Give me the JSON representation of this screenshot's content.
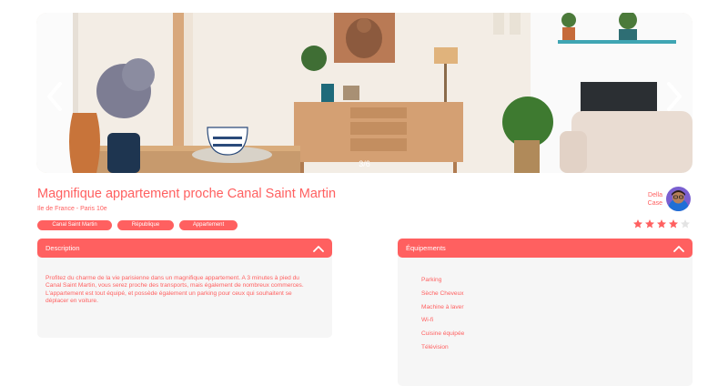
{
  "carousel": {
    "counter": "3/6"
  },
  "listing": {
    "title": "Magnifique appartement proche Canal Saint Martin",
    "location": "Ile de France - Paris 10e",
    "tags": [
      "Canal Saint Martin",
      "République",
      "Appartement"
    ],
    "rating": 4,
    "rating_max": 5
  },
  "host": {
    "first_name": "Della",
    "last_name": "Case"
  },
  "description": {
    "title": "Description",
    "text": "Profitez du charme de la vie parisienne dans un magnifique appartement. A 3 minutes à pied du Canal Saint Martin, vous serez proche des transports, mais également de nombreux commerces. L'appartement est tout équipé, et possède également un parking pour ceux qui souhaitent se déplacer en voiture."
  },
  "equipments": {
    "title": "Équipements",
    "items": [
      "Parking",
      "Sèche Cheveux",
      "Machine à laver",
      "Wi-fi",
      "Cuisine équipée",
      "Télévision"
    ]
  },
  "colors": {
    "accent": "#ff6060",
    "panel_bg": "#f6f6f6"
  }
}
